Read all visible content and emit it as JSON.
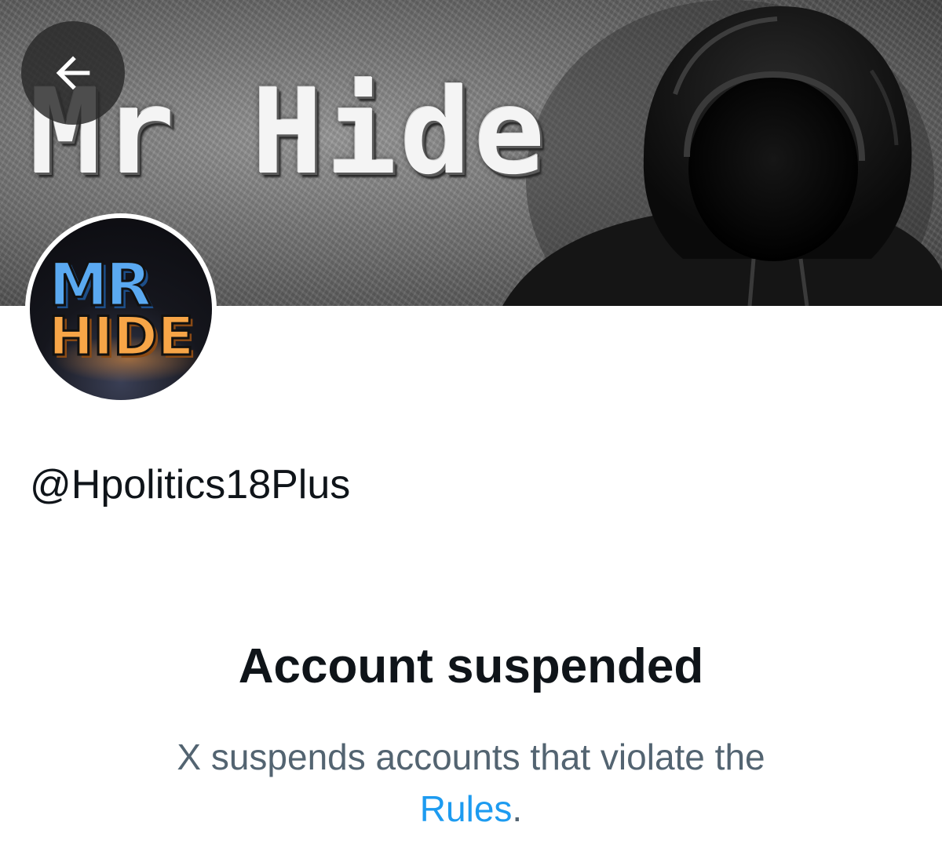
{
  "banner": {
    "title": "Mr Hide",
    "art_icon": "hooded-figure"
  },
  "nav": {
    "back_icon": "arrow-left-icon"
  },
  "avatar": {
    "line1": "MR",
    "line2": "HIDE"
  },
  "profile": {
    "handle": "@Hpolitics18Plus"
  },
  "notice": {
    "title": "Account suspended",
    "message": "X suspends accounts that violate the",
    "link_label": "Rules",
    "link_suffix": "."
  },
  "colors": {
    "text_primary": "#0f1419",
    "text_secondary": "#536471",
    "link": "#1d9bf0"
  }
}
